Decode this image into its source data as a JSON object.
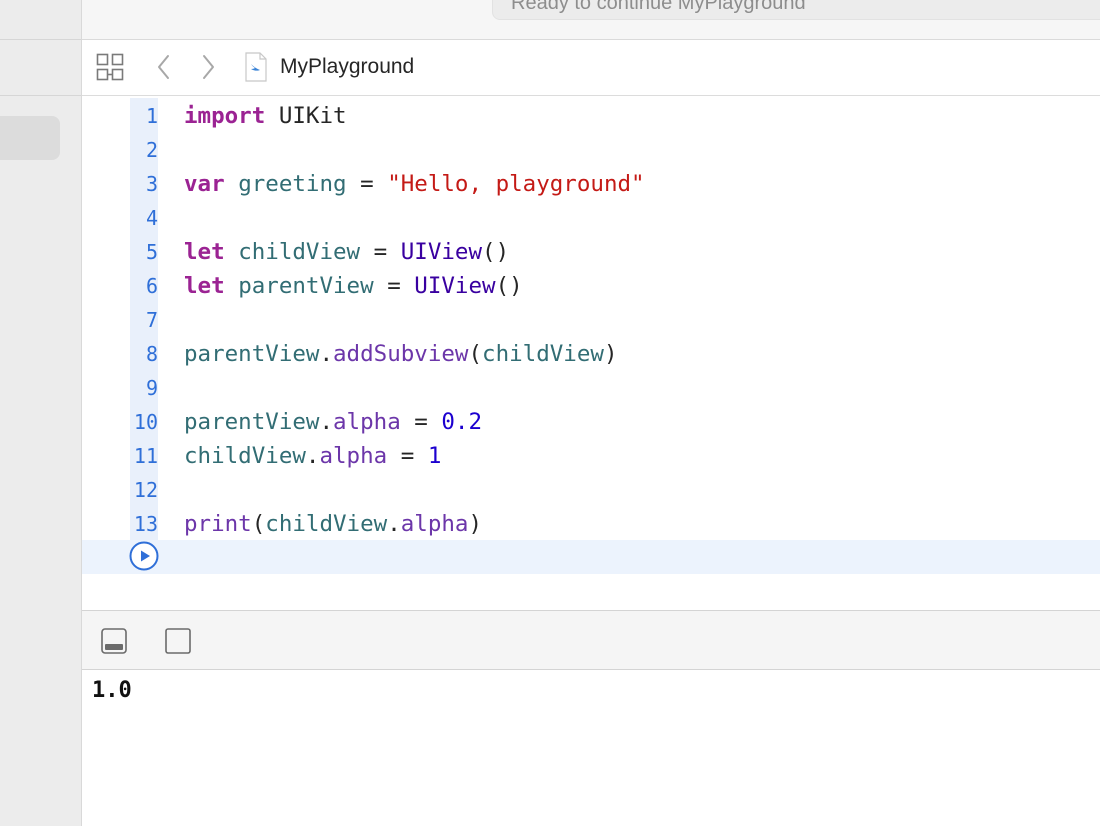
{
  "toolbar": {
    "status_text": "Ready to continue MyPlayground"
  },
  "jumpbar": {
    "grid_icon": "related-items-grid-icon",
    "back_icon": "chevron-left-icon",
    "forward_icon": "chevron-right-icon",
    "file_icon": "swift-file-icon",
    "file_name": "MyPlayground"
  },
  "editor": {
    "lines": [
      {
        "num": "1"
      },
      {
        "num": "2"
      },
      {
        "num": "3"
      },
      {
        "num": "4"
      },
      {
        "num": "5"
      },
      {
        "num": "6"
      },
      {
        "num": "7"
      },
      {
        "num": "8"
      },
      {
        "num": "9"
      },
      {
        "num": "10"
      },
      {
        "num": "11"
      },
      {
        "num": "12"
      },
      {
        "num": "13"
      }
    ],
    "tokens": {
      "l1_kw": "import",
      "l1_rest": " UIKit",
      "l3_kw": "var",
      "l3_name": "greeting",
      "l3_eq": " = ",
      "l3_str": "\"Hello, playground\"",
      "l5_kw": "let",
      "l5_name": "childView",
      "l5_eq": " = ",
      "l5_type": "UIView",
      "l5_call": "()",
      "l6_kw": "let",
      "l6_name": "parentView",
      "l6_eq": " = ",
      "l6_type": "UIView",
      "l6_call": "()",
      "l8_obj": "parentView",
      "l8_dot": ".",
      "l8_method": "addSubview",
      "l8_open": "(",
      "l8_arg": "childView",
      "l8_close": ")",
      "l10_obj": "parentView",
      "l10_dot": ".",
      "l10_prop": "alpha",
      "l10_eq": " = ",
      "l10_num": "0.2",
      "l11_obj": "childView",
      "l11_dot": ".",
      "l11_prop": "alpha",
      "l11_eq": " = ",
      "l11_num": "1",
      "l13_fn": "print",
      "l13_open": "(",
      "l13_obj": "childView",
      "l13_dot": ".",
      "l13_prop": "alpha",
      "l13_close": ")"
    },
    "run_icon": "play-circle-icon"
  },
  "debug": {
    "hide_icon": "hide-debug-area-icon",
    "toggle_icon": "console-toggle-icon"
  },
  "console": {
    "output": "1.0"
  },
  "colors": {
    "line_number": "#2f6fd8",
    "keyword": "#9b2393",
    "string": "#c41a16",
    "number": "#1c00cf",
    "current_line": "#ecf3fd"
  }
}
